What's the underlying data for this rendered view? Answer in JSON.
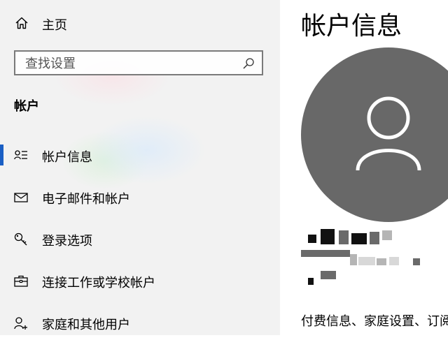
{
  "sidebar": {
    "home_label": "主页",
    "search": {
      "placeholder": "查找设置",
      "value": ""
    },
    "section_title": "帐户",
    "items": [
      {
        "label": "帐户信息",
        "icon": "account-info-icon",
        "active": true
      },
      {
        "label": "电子邮件和帐户",
        "icon": "mail-icon",
        "active": false
      },
      {
        "label": "登录选项",
        "icon": "key-icon",
        "active": false
      },
      {
        "label": "连接工作或学校帐户",
        "icon": "briefcase-icon",
        "active": false
      },
      {
        "label": "家庭和其他用户",
        "icon": "add-person-icon",
        "active": false
      }
    ]
  },
  "main": {
    "title": "帐户信息",
    "billing_text": "付费信息、家庭设置、订阅"
  },
  "colors": {
    "accent": "#1a5fc4",
    "avatar_bg": "#686868",
    "sidebar_bg": "#f2f2f2"
  }
}
